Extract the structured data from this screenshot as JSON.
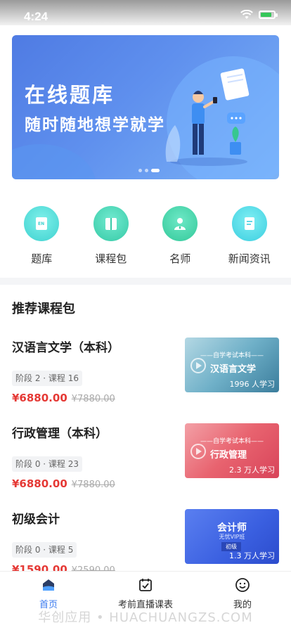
{
  "status_bar": {
    "time": "4:24"
  },
  "banner": {
    "title": "在线题库",
    "subtitle": "随时随地想学就学",
    "active_slide": 3,
    "slide_count": 3
  },
  "quick_nav": [
    {
      "label": "题库",
      "icon": "book-en-icon",
      "color": "#4fd8d5"
    },
    {
      "label": "课程包",
      "icon": "folder-icon",
      "color": "#3fd3b5"
    },
    {
      "label": "名师",
      "icon": "teacher-icon",
      "color": "#3fd3a8"
    },
    {
      "label": "新闻资讯",
      "icon": "news-icon",
      "color": "#4fd8e6"
    }
  ],
  "section": {
    "title": "推荐课程包"
  },
  "courses": [
    {
      "name": "汉语言文学（本科）",
      "meta": "阶段 2 · 课程 16",
      "price": "¥6880.00",
      "old_price": "¥7880.00",
      "thumb_tag": "——自学考试本科——",
      "thumb_title": "汉语言文学",
      "thumb_count": "1996 人学习"
    },
    {
      "name": "行政管理（本科）",
      "meta": "阶段 0 · 课程 23",
      "price": "¥6880.00",
      "old_price": "¥7880.00",
      "thumb_tag": "——自学考试本科——",
      "thumb_title": "行政管理",
      "thumb_count": "2.3 万人学习"
    },
    {
      "name": "初级会计",
      "meta": "阶段 0 · 课程 5",
      "price": "¥1590.00",
      "old_price": "¥2590.00",
      "thumb_title": "会计师",
      "thumb_sub": "无忧VIP班",
      "thumb_badge": "初级",
      "thumb_count": "1.3 万人学习"
    }
  ],
  "tabs": [
    {
      "label": "首页",
      "icon": "home-icon",
      "active": true
    },
    {
      "label": "考前直播课表",
      "icon": "calendar-check-icon",
      "active": false
    },
    {
      "label": "我的",
      "icon": "smiley-icon",
      "active": false
    }
  ],
  "watermark": "华创应用 • HUACHUANGZS.COM",
  "colors": {
    "accent": "#3b7bef",
    "price": "#e53935"
  }
}
